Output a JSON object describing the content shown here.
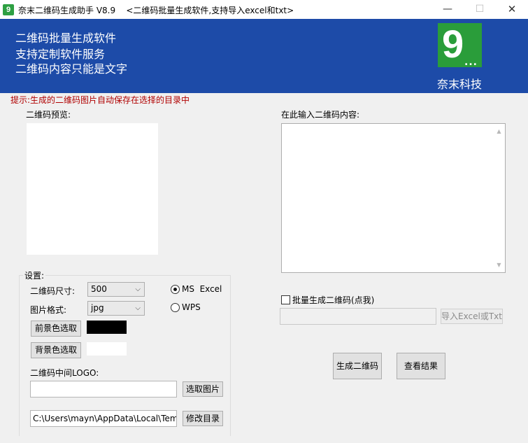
{
  "window": {
    "title": "奈末二维码生成助手 V8.9    <二维码批量生成软件,支持导入excel和txt>",
    "icon_letter": "9",
    "controls": {
      "minimize": "—",
      "maximize": "☐",
      "close": "✕"
    }
  },
  "banner": {
    "lines": [
      "二维码批量生成软件",
      "支持定制软件服务",
      "二维码内容只能是文字"
    ],
    "logo_number": "9",
    "logo_dots": "...",
    "company": "奈末科技",
    "bg_color": "#1d4ba8",
    "logo_color": "#2a9d3a"
  },
  "hint": "提示:生成的二维码图片自动保存在选择的目录中",
  "preview": {
    "label": "二维码预览:"
  },
  "content": {
    "label": "在此输入二维码内容:",
    "value": ""
  },
  "settings": {
    "group_title": "设置:",
    "size_label": "二维码尺寸:",
    "size_value": "500",
    "format_label": "图片格式:",
    "format_value": "jpg",
    "radio_excel": "MS  Excel",
    "radio_wps": "WPS",
    "selected_radio": "excel",
    "fg_button": "前景色选取",
    "fg_color": "#000000",
    "bg_button": "背景色选取",
    "bg_color": "#ffffff",
    "logo_label": "二维码中间LOGO:",
    "logo_path": "",
    "pick_image_button": "选取图片",
    "dir_path": "C:\\Users\\mayn\\AppData\\Local\\Temp\\",
    "change_dir_button": "修改目录"
  },
  "batch": {
    "checkbox_label": "批量生成二维码(点我)",
    "checked": false,
    "path": "",
    "import_button": "导入Excel或Txt"
  },
  "actions": {
    "generate": "生成二维码",
    "view_result": "查看结果"
  }
}
